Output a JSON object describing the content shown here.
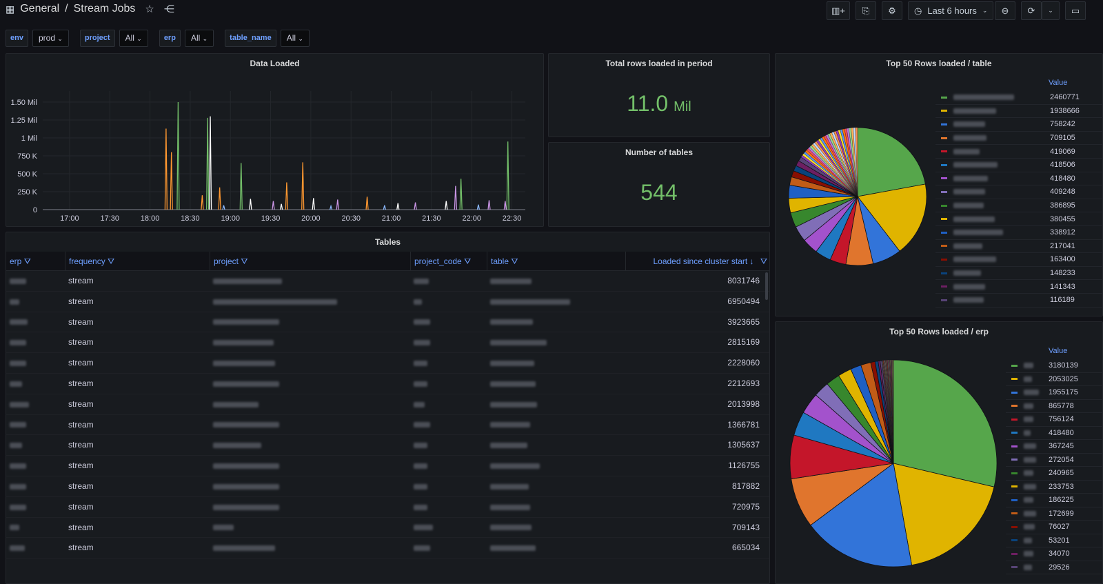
{
  "header": {
    "folder": "General",
    "separator": "/",
    "title": "Stream Jobs",
    "time_range": "Last 6 hours"
  },
  "variables": [
    {
      "name": "env",
      "value": "prod"
    },
    {
      "name": "project",
      "value": "All"
    },
    {
      "name": "erp",
      "value": "All"
    },
    {
      "name": "table_name",
      "value": "All"
    }
  ],
  "panels": {
    "data_loaded": {
      "title": "Data Loaded"
    },
    "total_rows": {
      "title": "Total rows loaded in period",
      "value": "11.0",
      "unit": "Mil"
    },
    "num_tables": {
      "title": "Number of tables",
      "value": "544"
    },
    "pie_table": {
      "title": "Top 50 Rows loaded / table",
      "legend_header": "Value"
    },
    "pie_erp": {
      "title": "Top 50 Rows loaded / erp",
      "legend_header": "Value"
    },
    "tables": {
      "title": "Tables"
    }
  },
  "table": {
    "columns": [
      "erp",
      "frequency",
      "project",
      "project_code",
      "table",
      "Loaded since cluster start ↓"
    ],
    "rows": [
      {
        "frequency": "stream",
        "loaded": "8031746"
      },
      {
        "frequency": "stream",
        "loaded": "6950494"
      },
      {
        "frequency": "stream",
        "loaded": "3923665"
      },
      {
        "frequency": "stream",
        "loaded": "2815169"
      },
      {
        "frequency": "stream",
        "loaded": "2228060"
      },
      {
        "frequency": "stream",
        "loaded": "2212693"
      },
      {
        "frequency": "stream",
        "loaded": "2013998"
      },
      {
        "frequency": "stream",
        "loaded": "1366781"
      },
      {
        "frequency": "stream",
        "loaded": "1305637"
      },
      {
        "frequency": "stream",
        "loaded": "1126755"
      },
      {
        "frequency": "stream",
        "loaded": "817882"
      },
      {
        "frequency": "stream",
        "loaded": "720975"
      },
      {
        "frequency": "stream",
        "loaded": "709143"
      },
      {
        "frequency": "stream",
        "loaded": "665034"
      }
    ]
  },
  "chart_data": [
    {
      "type": "line",
      "title": "Data Loaded",
      "x_ticks": [
        "17:00",
        "17:30",
        "18:00",
        "18:30",
        "19:00",
        "19:30",
        "20:00",
        "20:30",
        "21:00",
        "21:30",
        "22:00",
        "22:30"
      ],
      "y_ticks": [
        "0",
        "250 K",
        "500 K",
        "750 K",
        "1 Mil",
        "1.25 Mil",
        "1.50 Mil"
      ],
      "ylim": [
        0,
        1500000
      ],
      "xlim": [
        "16:40",
        "22:40"
      ],
      "series": [
        {
          "color": "#73bf69",
          "spikes": [
            [
              "18:21",
              1500000
            ],
            [
              "18:43",
              1280000
            ],
            [
              "19:08",
              650000
            ],
            [
              "21:52",
              430000
            ],
            [
              "22:27",
              950000
            ]
          ]
        },
        {
          "color": "#ff9830",
          "spikes": [
            [
              "18:12",
              1130000
            ],
            [
              "18:16",
              800000
            ],
            [
              "18:39",
              200000
            ],
            [
              "18:52",
              310000
            ],
            [
              "19:42",
              380000
            ],
            [
              "19:54",
              660000
            ],
            [
              "20:42",
              180000
            ]
          ]
        },
        {
          "color": "#ffffff",
          "spikes": [
            [
              "18:45",
              1300000
            ],
            [
              "19:15",
              150000
            ],
            [
              "19:38",
              80000
            ],
            [
              "20:02",
              160000
            ],
            [
              "21:05",
              90000
            ],
            [
              "21:41",
              120000
            ]
          ]
        },
        {
          "color": "#ca95e5",
          "spikes": [
            [
              "19:32",
              120000
            ],
            [
              "20:20",
              140000
            ],
            [
              "21:18",
              100000
            ],
            [
              "21:48",
              330000
            ],
            [
              "22:13",
              130000
            ],
            [
              "22:25",
              120000
            ]
          ]
        },
        {
          "color": "#8ab8ff",
          "spikes": [
            [
              "18:55",
              60000
            ],
            [
              "20:15",
              50000
            ],
            [
              "20:55",
              60000
            ],
            [
              "22:05",
              70000
            ]
          ]
        }
      ]
    },
    {
      "type": "pie",
      "title": "Top 50 Rows loaded / table",
      "legend_position": "right",
      "values": [
        2460771,
        1938666,
        758242,
        709105,
        419069,
        418506,
        418480,
        409248,
        386895,
        380455,
        338912,
        217041,
        163400,
        148233,
        141343,
        116189
      ],
      "colors": [
        "#56a64b",
        "#e0b400",
        "#3274d9",
        "#e0752d",
        "#c4162a",
        "#1f78c1",
        "#a352cc",
        "#806eb7",
        "#37872d",
        "#e0b400",
        "#1f60c4",
        "#c15c17",
        "#890f02",
        "#0a437c",
        "#6d1f62",
        "#584477"
      ],
      "rest_total": 1700000
    },
    {
      "type": "pie",
      "title": "Top 50 Rows loaded / erp",
      "legend_position": "right",
      "values": [
        3180139,
        2053025,
        1955175,
        865778,
        756124,
        418480,
        367245,
        272054,
        240965,
        233753,
        186225,
        172699,
        76027,
        53201,
        34070,
        29526
      ],
      "colors": [
        "#56a64b",
        "#e0b400",
        "#3274d9",
        "#e0752d",
        "#c4162a",
        "#1f78c1",
        "#a352cc",
        "#806eb7",
        "#37872d",
        "#e0b400",
        "#1f60c4",
        "#c15c17",
        "#890f02",
        "#0a437c",
        "#6d1f62",
        "#584477"
      ],
      "rest_total": 200000
    }
  ]
}
